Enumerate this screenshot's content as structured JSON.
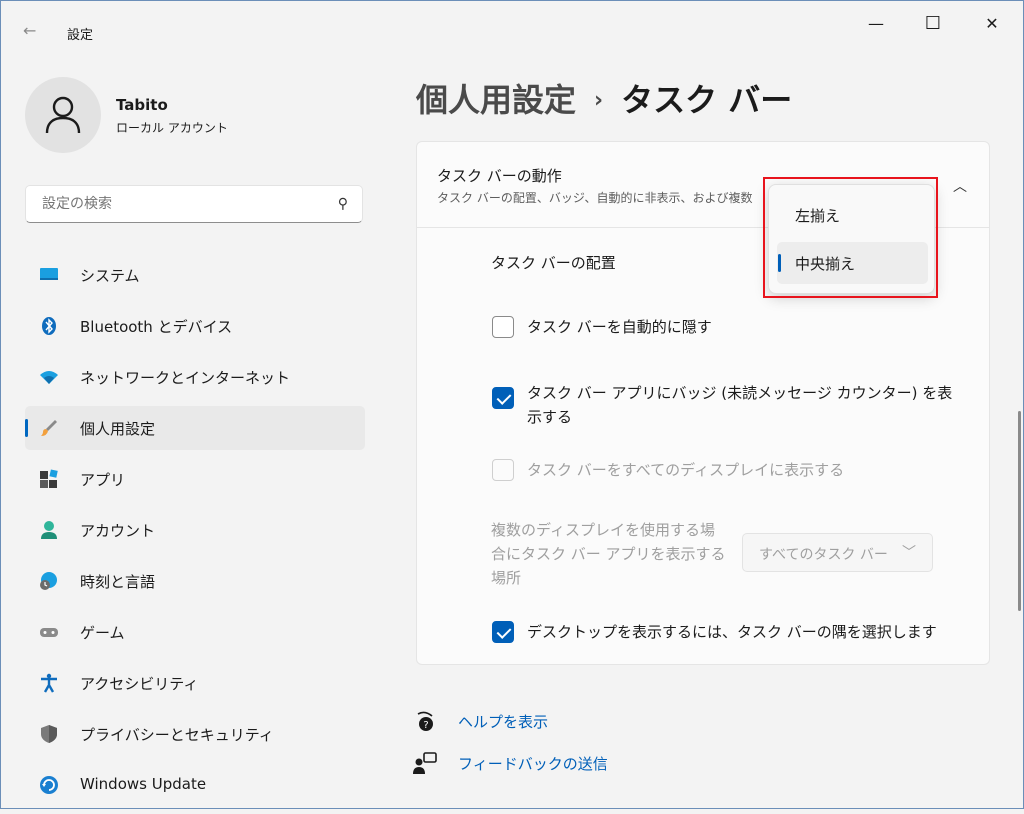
{
  "window": {
    "title": "設定",
    "back_glyph": "←",
    "min_glyph": "—",
    "max_glyph": "☐",
    "close_glyph": "✕"
  },
  "user": {
    "name": "Tabito",
    "type": "ローカル アカウント"
  },
  "search": {
    "placeholder": "設定の検索"
  },
  "nav": [
    {
      "label": "システム",
      "icon": "display-icon"
    },
    {
      "label": "Bluetooth とデバイス",
      "icon": "bluetooth-icon"
    },
    {
      "label": "ネットワークとインターネット",
      "icon": "wifi-icon"
    },
    {
      "label": "個人用設定",
      "icon": "paintbrush-icon",
      "active": true
    },
    {
      "label": "アプリ",
      "icon": "apps-icon"
    },
    {
      "label": "アカウント",
      "icon": "account-icon"
    },
    {
      "label": "時刻と言語",
      "icon": "globe-clock-icon"
    },
    {
      "label": "ゲーム",
      "icon": "gamepad-icon"
    },
    {
      "label": "アクセシビリティ",
      "icon": "accessibility-icon"
    },
    {
      "label": "プライバシーとセキュリティ",
      "icon": "shield-icon"
    },
    {
      "label": "Windows Update",
      "icon": "update-icon"
    }
  ],
  "breadcrumb": {
    "parent": "個人用設定",
    "separator": "›",
    "current": "タスク バー"
  },
  "section": {
    "title": "タスク バーの動作",
    "subtitle": "タスク バーの配置、バッジ、自動的に非表示、および複数"
  },
  "rows": {
    "alignment_label": "タスク バーの配置",
    "autohide": {
      "label": "タスク バーを自動的に隠す",
      "checked": false
    },
    "badges": {
      "line1": "タスク バー アプリにバッジ (未読メッセージ カウンター) を表",
      "line2": "示する",
      "checked": true
    },
    "all_displays": {
      "label": "タスク バーをすべてのディスプレイに表示する",
      "checked": false,
      "disabled": true
    },
    "multi_display": {
      "line1": "複数のディスプレイを使用する場",
      "line2": "合にタスク バー アプリを表示する",
      "line3": "場所",
      "value": "すべてのタスク バー"
    },
    "corner": {
      "label": "デスクトップを表示するには、タスク バーの隅を選択します",
      "checked": true
    }
  },
  "popup": {
    "options": [
      "左揃え",
      "中央揃え"
    ],
    "selected": "中央揃え"
  },
  "links": {
    "help": "ヘルプを表示",
    "feedback": "フィードバックの送信"
  },
  "colors": {
    "accent": "#005fb8",
    "highlight": "#e8141d"
  }
}
